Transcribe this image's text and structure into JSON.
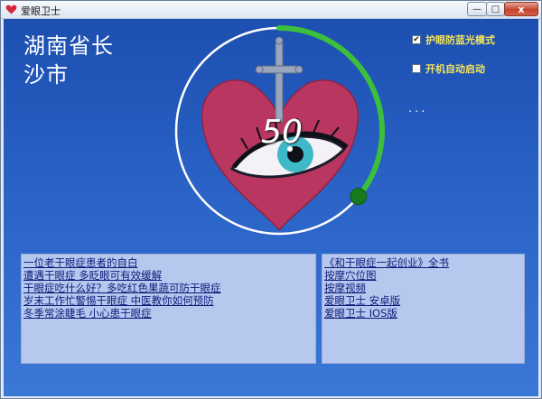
{
  "window": {
    "title": "爱眼卫士",
    "controls": {
      "minimize": "—",
      "maximize": "□",
      "close": "x"
    }
  },
  "location": {
    "line1": "湖南省长",
    "line2": "沙市"
  },
  "gauge": {
    "value": "50",
    "progress_fraction": 0.36
  },
  "options": [
    {
      "label": "护眼防蓝光模式",
      "checked": true
    },
    {
      "label": "开机自动启动",
      "checked": false
    }
  ],
  "more_label": "...",
  "articles": [
    "一位老干眼症患者的自白",
    "遭遇干眼症 多眨眼可有效缓解",
    "干眼症吃什么好？多吃红色果蔬可防干眼症",
    "岁末工作忙警惕干眼症 中医教你如何预防",
    "冬季常涂睫毛 小心患干眼症"
  ],
  "links": [
    "《和干眼症一起创业》全书",
    "按摩穴位图",
    "按摩视频",
    "爱眼卫士 安卓版",
    "爱眼卫士 IOS版"
  ],
  "colors": {
    "background_top": "#1c4fb0",
    "background_bottom": "#3a78d6",
    "progress_arc": "#3cbf3c",
    "heart": "#b8365f",
    "option_text": "#f3e45a",
    "link_text": "#0d1a7a",
    "panel_bg": "#b7c8ef"
  },
  "icons": {
    "app": "heart-icon",
    "cross": "cross-icon",
    "eye": "eye-icon",
    "knob": "progress-knob"
  }
}
